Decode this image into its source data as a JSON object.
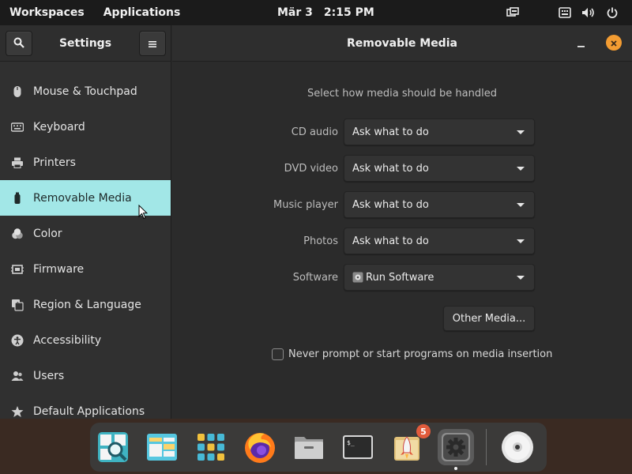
{
  "top_panel": {
    "workspaces": "Workspaces",
    "applications": "Applications",
    "date": "Mär 3",
    "time": "2:15 PM",
    "icons": [
      "multitasking-icon",
      "keyboard-icon",
      "volume-icon",
      "power-icon"
    ]
  },
  "sidebar": {
    "title": "Settings",
    "items": [
      {
        "label": "Mouse & Touchpad",
        "icon": "mouse-icon"
      },
      {
        "label": "Keyboard",
        "icon": "keyboard-icon"
      },
      {
        "label": "Printers",
        "icon": "printer-icon"
      },
      {
        "label": "Removable Media",
        "icon": "usb-icon",
        "active": true
      },
      {
        "label": "Color",
        "icon": "color-icon"
      },
      {
        "label": "Firmware",
        "icon": "chip-icon"
      },
      {
        "label": "Region & Language",
        "icon": "language-icon"
      },
      {
        "label": "Accessibility",
        "icon": "accessibility-icon"
      },
      {
        "label": "Users",
        "icon": "users-icon"
      },
      {
        "label": "Default Applications",
        "icon": "star-icon"
      }
    ]
  },
  "main": {
    "title": "Removable Media",
    "subtitle": "Select how media should be handled",
    "rows": [
      {
        "label": "CD audio",
        "value": "Ask what to do"
      },
      {
        "label": "DVD video",
        "value": "Ask what to do"
      },
      {
        "label": "Music player",
        "value": "Ask what to do"
      },
      {
        "label": "Photos",
        "value": "Ask what to do"
      },
      {
        "label": "Software",
        "value": "Run Software"
      }
    ],
    "other_media_button": "Other Media...",
    "never_prompt_label": "Never prompt or start programs on media insertion",
    "never_prompt_checked": false
  },
  "dock": {
    "items": [
      "search-app-icon",
      "files-app-icon",
      "app-grid-icon",
      "firefox-icon",
      "file-manager-icon",
      "terminal-icon",
      "appcenter-icon",
      "settings-app-icon",
      "disc-icon"
    ],
    "appcenter_badge": "5",
    "active": "settings-app-icon"
  },
  "colors": {
    "accent": "#a2e7e7",
    "close_button": "#f39c32",
    "badge": "#e25b3c"
  }
}
